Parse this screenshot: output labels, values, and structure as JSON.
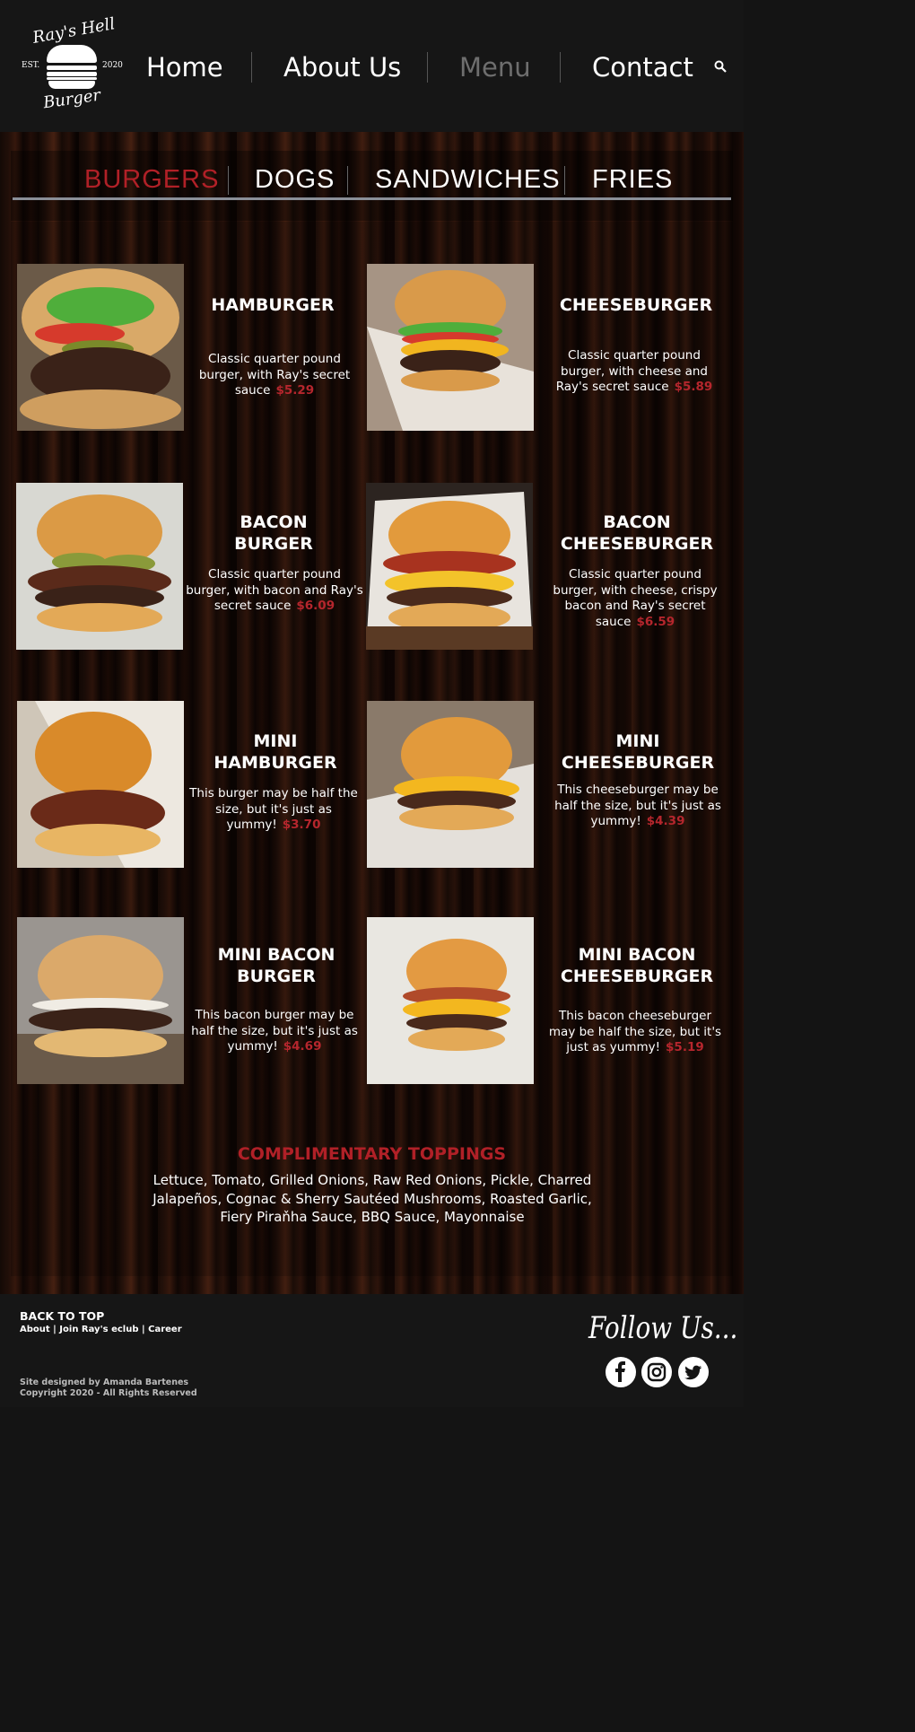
{
  "brand": {
    "logo_top": "Ray's Hell",
    "logo_bottom": "Burger",
    "logo_est": "EST.",
    "logo_year": "2020"
  },
  "nav": {
    "items": [
      {
        "label": "Home",
        "active": false
      },
      {
        "label": "About Us",
        "active": false
      },
      {
        "label": "Menu",
        "active": true
      },
      {
        "label": "Contact",
        "active": false
      }
    ],
    "search_icon": "search-icon"
  },
  "categories": [
    {
      "label": "BURGERS",
      "active": true
    },
    {
      "label": "DOGS",
      "active": false
    },
    {
      "label": "SANDWICHES",
      "active": false
    },
    {
      "label": "FRIES",
      "active": false
    }
  ],
  "menu_items": [
    {
      "title_lines": [
        "HAMBURGER"
      ],
      "desc": "Classic quarter pound burger, with Ray's secret sauce",
      "price": "$5.29"
    },
    {
      "title_lines": [
        "CHEESEBURGER"
      ],
      "desc": "Classic quarter pound burger, with cheese and Ray's secret sauce",
      "price": "$5.89"
    },
    {
      "title_lines": [
        "BACON",
        "BURGER"
      ],
      "desc": "Classic quarter pound burger, with bacon and Ray's secret sauce",
      "price": "$6.09"
    },
    {
      "title_lines": [
        "BACON",
        "CHEESEBURGER"
      ],
      "desc": "Classic quarter pound burger, with cheese, crispy bacon and Ray's secret sauce",
      "price": "$6.59"
    },
    {
      "title_lines": [
        "MINI",
        "HAMBURGER"
      ],
      "desc": "This burger may be half the size, but it's just as yummy!",
      "price": "$3.70"
    },
    {
      "title_lines": [
        "MINI",
        "CHEESEBURGER"
      ],
      "desc": "This cheeseburger may be half the size, but it's just as yummy!",
      "price": "$4.39"
    },
    {
      "title_lines": [
        "MINI BACON",
        "BURGER"
      ],
      "desc": "This bacon burger may be half the size, but it's just as yummy!",
      "price": "$4.69"
    },
    {
      "title_lines": [
        "MINI BACON",
        "CHEESEBURGER"
      ],
      "desc": "This bacon cheeseburger may be half the size, but it's just as yummy!",
      "price": "$5.19"
    }
  ],
  "toppings": {
    "title": "COMPLIMENTARY TOPPINGS",
    "text": "Lettuce, Tomato, Grilled Onions, Raw Red Onions, Pickle, Charred Jalapeños, Cognac & Sherry Sautéed Mushrooms, Roasted Garlic, Fiery Piraňha Sauce, BBQ Sauce, Mayonnaise"
  },
  "footer": {
    "back_to_top": "BACK TO TOP",
    "links": [
      "About",
      "Join Ray's eclub",
      "Career"
    ],
    "credit_line1": "Site designed by Amanda Bartenes",
    "credit_line2": "Copyright 2020 - All Rights Reserved",
    "follow": "Follow Us...",
    "social_icons": [
      "facebook-icon",
      "instagram-icon",
      "twitter-icon"
    ]
  },
  "colors": {
    "accent": "#b02027",
    "price": "#b5262d",
    "nav_active": "#6e6e6e",
    "header_bg": "#161616"
  }
}
